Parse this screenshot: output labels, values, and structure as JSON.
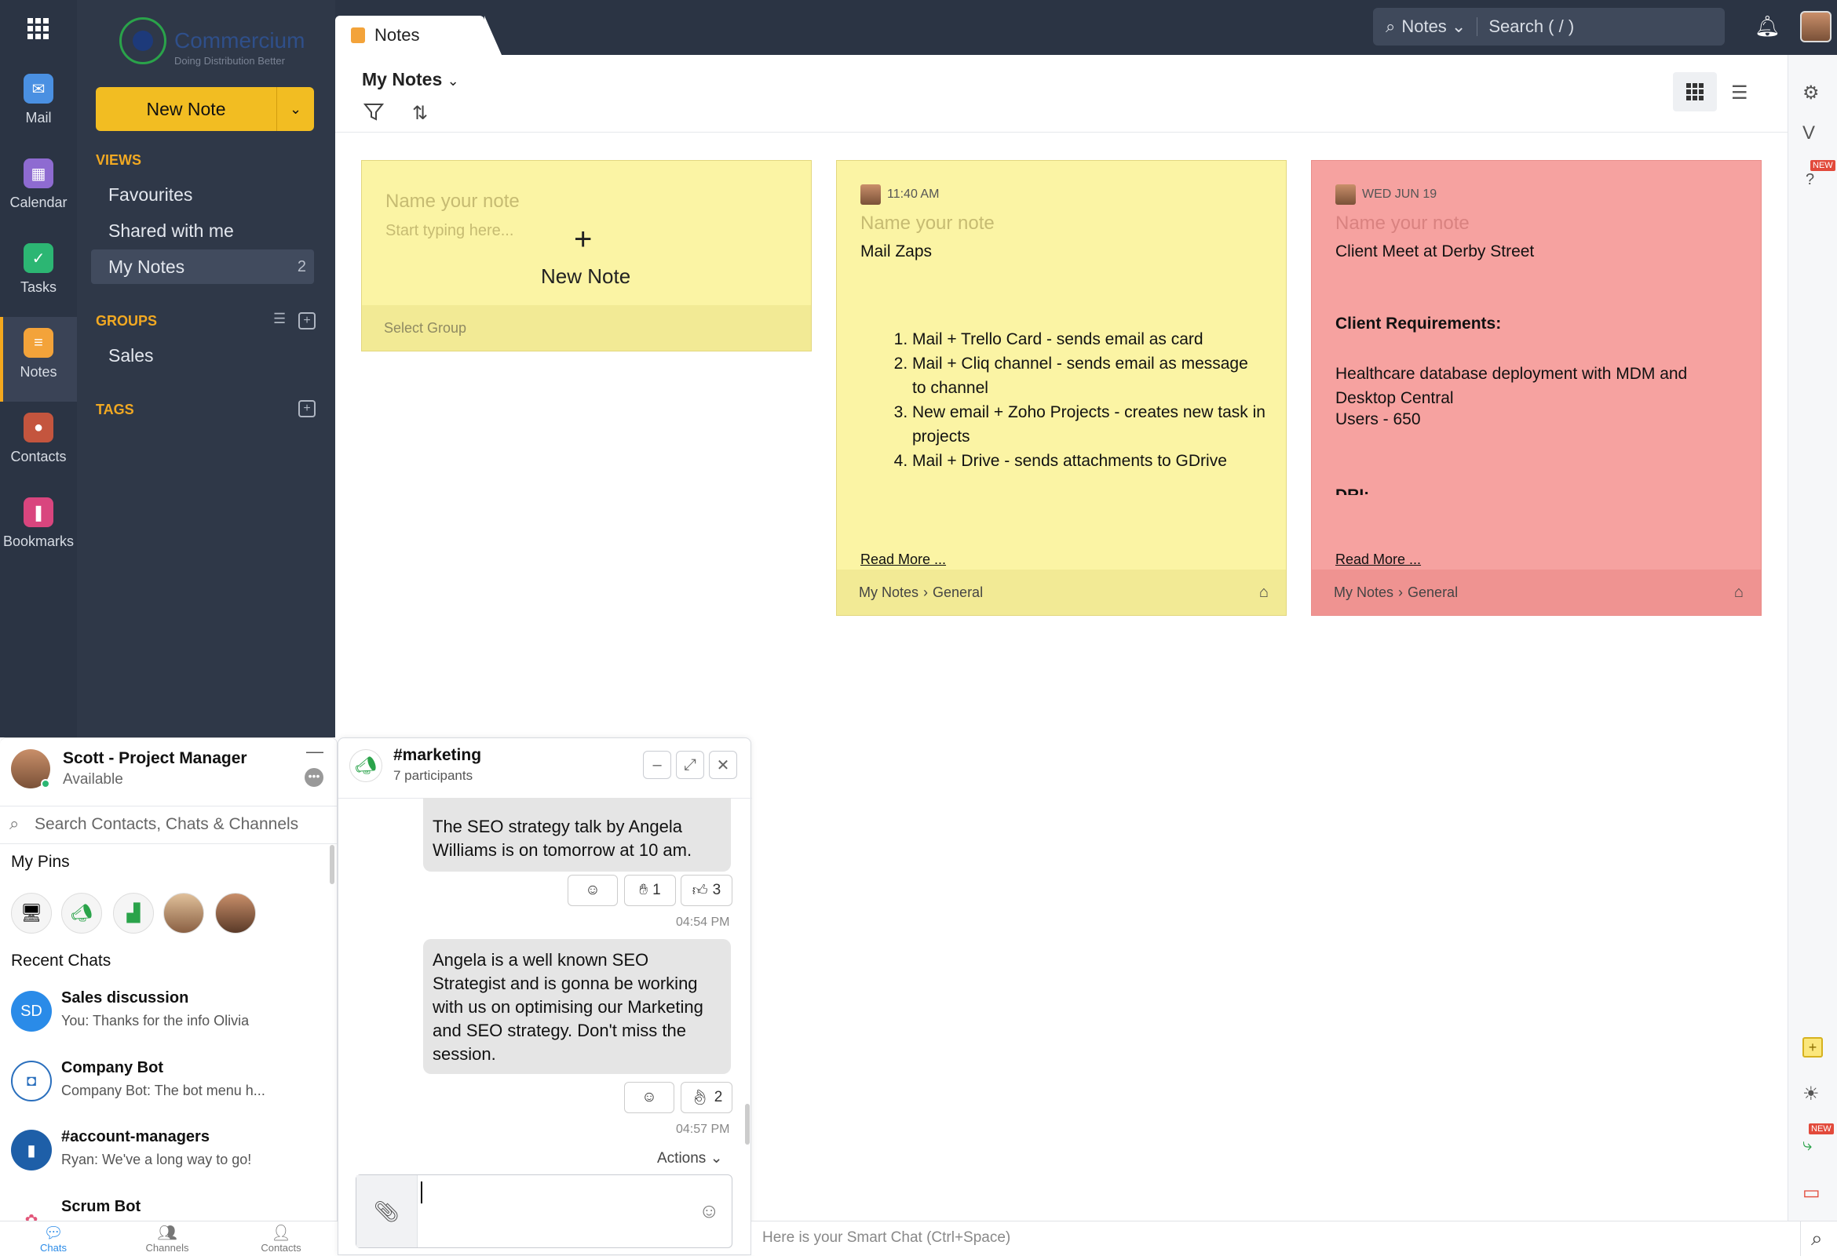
{
  "app": {
    "logo_text": "Commercium",
    "logo_tagline": "Doing Distribution Better"
  },
  "rail": [
    {
      "label": "Mail",
      "icon": "mail-icon",
      "color": "#4a90e2"
    },
    {
      "label": "Calendar",
      "icon": "calendar-icon",
      "color": "#8e6bd1"
    },
    {
      "label": "Tasks",
      "icon": "tasks-icon",
      "color": "#2cb673"
    },
    {
      "label": "Notes",
      "icon": "notes-icon",
      "color": "#f3a33a",
      "active": true
    },
    {
      "label": "Contacts",
      "icon": "contacts-icon",
      "color": "#c4553e"
    },
    {
      "label": "Bookmarks",
      "icon": "bookmarks-icon",
      "color": "#d9457e"
    }
  ],
  "sidebar": {
    "new_note": "New Note",
    "views_head": "VIEWS",
    "views": [
      {
        "label": "Favourites"
      },
      {
        "label": "Shared with me"
      },
      {
        "label": "My Notes",
        "count": "2"
      }
    ],
    "groups_head": "GROUPS",
    "groups": [
      {
        "label": "Sales"
      }
    ],
    "tags_head": "TAGS"
  },
  "topbar": {
    "tab_label": "Notes",
    "search_scope": "Notes",
    "search_placeholder": "Search ( / )"
  },
  "toolbar": {
    "title": "My Notes"
  },
  "notes": {
    "new": {
      "name_placeholder": "Name your note",
      "body_placeholder": "Start typing here...",
      "new_label": "New Note",
      "group_placeholder": "Select Group"
    },
    "note1": {
      "time": "11:40 AM",
      "name_placeholder": "Name your note",
      "title": "Mail Zaps",
      "items": [
        "Mail + Trello Card - sends email as card",
        "Mail + Cliq channel - sends email as message to channel",
        "New email + Zoho Projects - creates new task in projects",
        "Mail + Drive - sends attachments to GDrive"
      ],
      "read_more": "Read More ...",
      "path_root": "My Notes",
      "path_group": "General"
    },
    "note2": {
      "time": "WED JUN 19",
      "name_placeholder": "Name your note",
      "title": "Client Meet at Derby Street",
      "req_head": "Client Requirements:",
      "line1": "Healthcare database deployment with MDM and Desktop Central",
      "line2": "Users - 650",
      "cut": "DRI:",
      "read_more": "Read More ...",
      "path_root": "My Notes",
      "path_group": "General",
      "color": "#f6a2a0"
    }
  },
  "chat": {
    "user_name": "Scott - Project Manager",
    "user_status": "Available",
    "search_placeholder": "Search Contacts, Chats & Channels",
    "pins_head": "My Pins",
    "recent_head": "Recent Chats",
    "recent": [
      {
        "initials": "SD",
        "name": "Sales discussion",
        "preview": "You: Thanks for the info Olivia"
      },
      {
        "initials": "",
        "name": "Company Bot",
        "preview": "Company Bot: The bot menu h..."
      },
      {
        "initials": "",
        "name": "#account-managers",
        "preview": "Ryan: We've a long way to go!"
      },
      {
        "initials": "",
        "name": "Scrum Bot",
        "preview": ""
      }
    ],
    "tabs": [
      "Chats",
      "Channels",
      "Contacts"
    ]
  },
  "channel": {
    "name": "#marketing",
    "participants": "7 participants",
    "msg1": "The SEO strategy talk by Angela Williams is on tomorrow at 10 am.",
    "msg1_r1": "1",
    "msg1_r2": "3",
    "msg1_time": "04:54 PM",
    "msg2": "Angela is a well known SEO Strategist and is gonna be working with us on optimising our Marketing and SEO strategy. Don't miss the session.",
    "msg2_r1": "2",
    "msg2_time": "04:57 PM",
    "actions": "Actions"
  },
  "smart_chat": "Here is your Smart Chat (Ctrl+Space)",
  "badges": {
    "new": "NEW"
  }
}
